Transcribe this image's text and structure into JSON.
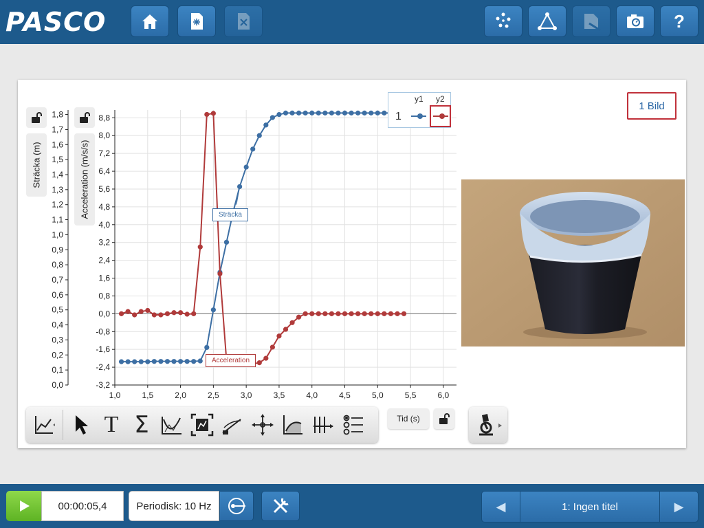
{
  "app": {
    "logo": "PASCO"
  },
  "toolbar_top": {
    "buttons": [
      {
        "name": "home-button",
        "icon": "home-icon"
      },
      {
        "name": "new-button",
        "icon": "new-document-icon"
      },
      {
        "name": "close-button",
        "icon": "close-document-icon",
        "disabled": true
      },
      {
        "name": "data-summary-button",
        "icon": "dots-icon"
      },
      {
        "name": "calculator-button",
        "icon": "triangle-icon"
      },
      {
        "name": "journal-button",
        "icon": "journal-icon",
        "disabled": true
      },
      {
        "name": "snapshot-button",
        "icon": "camera-icon"
      },
      {
        "name": "help-button",
        "icon": "question-icon",
        "label": "?"
      }
    ]
  },
  "graph": {
    "y1_label": "Sträcka (m)",
    "y2_label": "Acceleration (m/s/s)",
    "x_label": "Tid (s)",
    "legend": {
      "col1": "y1",
      "col2": "y2",
      "run": "1"
    },
    "annotation_y1": "Sträcka",
    "annotation_y2": "Acceleration",
    "colors": {
      "y1": "#3d6fa4",
      "y2": "#b03a3a",
      "grid": "#e2e2e2",
      "zero_line": "#888888"
    }
  },
  "chart_data": {
    "type": "line",
    "x_ticks": [
      "1,0",
      "1,5",
      "2,0",
      "2,5",
      "3,0",
      "3,5",
      "4,0",
      "4,5",
      "5,0",
      "5,5",
      "6,0"
    ],
    "xlim": [
      1.0,
      6.2
    ],
    "y1_ticks": [
      "0,0",
      "0,1",
      "0,2",
      "0,3",
      "0,4",
      "0,5",
      "0,6",
      "0,7",
      "0,8",
      "0,9",
      "1,0",
      "1,1",
      "1,2",
      "1,3",
      "1,4",
      "1,5",
      "1,6",
      "1,7",
      "1,8"
    ],
    "y1lim": [
      0.0,
      1.83
    ],
    "y2_ticks": [
      "-3,2",
      "-2,4",
      "-1,6",
      "-0,8",
      "0,0",
      "0,8",
      "1,6",
      "2,4",
      "3,2",
      "4,0",
      "4,8",
      "5,6",
      "6,4",
      "7,2",
      "8,0",
      "8,8"
    ],
    "y2lim": [
      -3.2,
      9.15
    ],
    "xlabel": "Tid (s)",
    "ylabel": "Sträcka (m)",
    "ylabel2": "Acceleration (m/s/s)",
    "series": [
      {
        "name": "Sträcka",
        "axis": "y1",
        "x": [
          1.1,
          1.2,
          1.3,
          1.4,
          1.5,
          1.6,
          1.7,
          1.8,
          1.9,
          2.0,
          2.1,
          2.2,
          2.3,
          2.4,
          2.5,
          2.6,
          2.7,
          2.8,
          2.9,
          3.0,
          3.1,
          3.2,
          3.3,
          3.4,
          3.5,
          3.6,
          3.7,
          3.8,
          3.9,
          4.0,
          4.1,
          4.2,
          4.3,
          4.4,
          4.5,
          4.6,
          4.7,
          4.8,
          4.9,
          5.0,
          5.1,
          5.2,
          5.3,
          5.4
        ],
        "values": [
          0.155,
          0.155,
          0.155,
          0.155,
          0.155,
          0.157,
          0.157,
          0.157,
          0.157,
          0.157,
          0.157,
          0.157,
          0.16,
          0.25,
          0.5,
          0.75,
          0.95,
          1.15,
          1.32,
          1.45,
          1.57,
          1.66,
          1.73,
          1.78,
          1.8,
          1.81,
          1.81,
          1.81,
          1.81,
          1.81,
          1.81,
          1.81,
          1.81,
          1.81,
          1.81,
          1.81,
          1.81,
          1.81,
          1.81,
          1.81,
          1.81,
          1.81,
          1.81,
          1.81
        ]
      },
      {
        "name": "Acceleration",
        "axis": "y2",
        "x": [
          1.1,
          1.2,
          1.3,
          1.4,
          1.5,
          1.6,
          1.7,
          1.8,
          1.9,
          2.0,
          2.1,
          2.2,
          2.3,
          2.4,
          2.5,
          2.6,
          2.7,
          2.8,
          2.9,
          3.0,
          3.1,
          3.2,
          3.3,
          3.4,
          3.5,
          3.6,
          3.7,
          3.8,
          3.9,
          4.0,
          4.1,
          4.2,
          4.3,
          4.4,
          4.5,
          4.6,
          4.7,
          4.8,
          4.9,
          5.0,
          5.1,
          5.2,
          5.3,
          5.4
        ],
        "values": [
          0.0,
          0.1,
          -0.05,
          0.1,
          0.15,
          -0.05,
          -0.05,
          0.0,
          0.05,
          0.05,
          -0.02,
          0.0,
          3.0,
          8.95,
          9.0,
          1.8,
          -2.1,
          -2.2,
          -2.25,
          -2.25,
          -2.25,
          -2.2,
          -2.0,
          -1.5,
          -1.0,
          -0.7,
          -0.4,
          -0.15,
          0.0,
          0.0,
          0.0,
          0.0,
          0.0,
          0.0,
          0.0,
          0.0,
          0.0,
          0.0,
          0.0,
          0.0,
          0.0,
          0.0,
          0.0,
          0.0
        ]
      }
    ],
    "grid": true,
    "legend": "top-right"
  },
  "image_panel": {
    "button_label": "1 Bild"
  },
  "graph_tools": {
    "items": [
      "graph-type-icon",
      "select-pointer-icon",
      "text-annotation-icon",
      "statistics-sigma-icon",
      "curve-fit-icon",
      "scale-to-fit-icon",
      "slope-tool-icon",
      "coordinates-tool-icon",
      "area-tool-icon",
      "add-axis-icon",
      "run-select-icon"
    ],
    "text_tool_label": "T",
    "sigma_label": "Σ"
  },
  "bottom": {
    "timer": "00:00:05,4",
    "sampling": "Periodisk: 10 Hz",
    "page_title": "1: Ingen titel",
    "prev_label": "◀",
    "next_label": "▶"
  }
}
